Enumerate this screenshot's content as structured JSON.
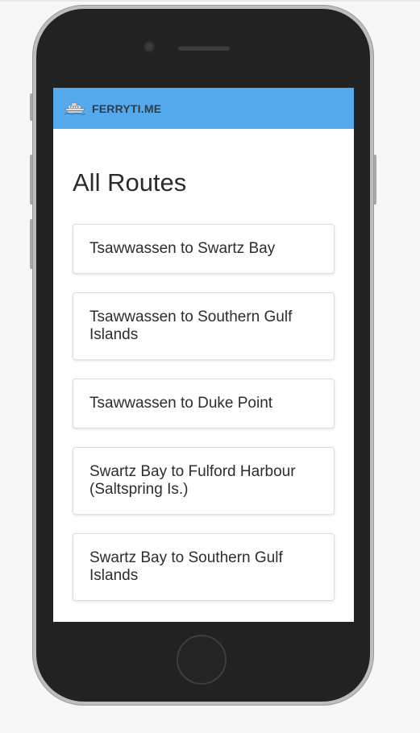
{
  "navbar": {
    "brand": "FERRYTI.ME",
    "icon": "ferry-icon",
    "background": "#55aaed"
  },
  "main": {
    "title": "All Routes",
    "routes": [
      {
        "label": "Tsawwassen to Swartz Bay"
      },
      {
        "label": "Tsawwassen to Southern Gulf Islands"
      },
      {
        "label": "Tsawwassen to Duke Point"
      },
      {
        "label": "Swartz Bay to Fulford Harbour (Saltspring Is.)"
      },
      {
        "label": "Swartz Bay to Southern Gulf Islands"
      }
    ]
  }
}
